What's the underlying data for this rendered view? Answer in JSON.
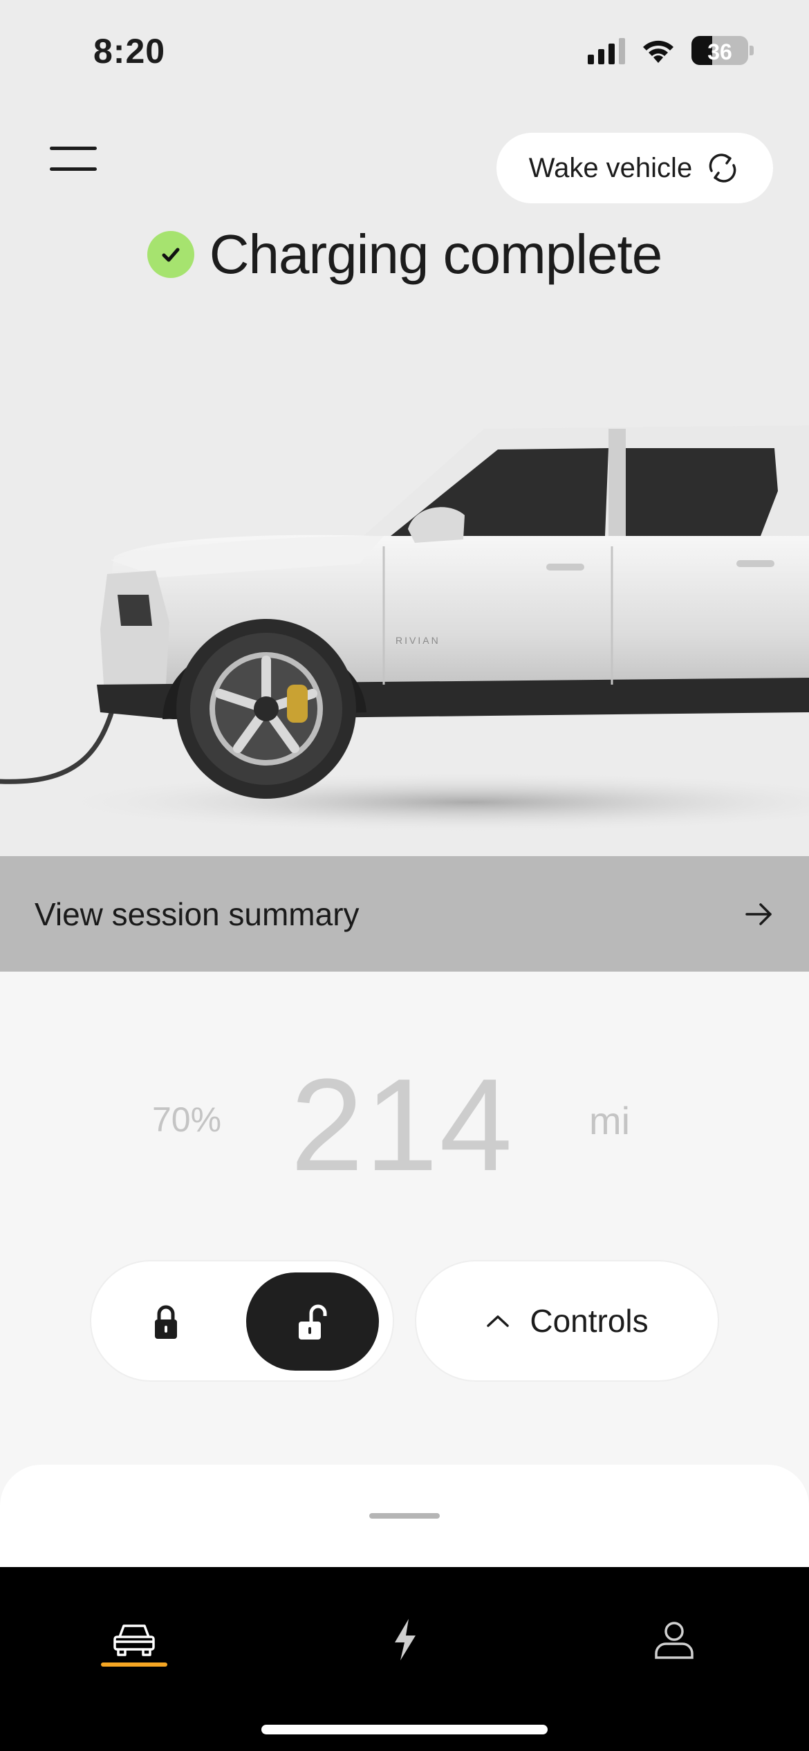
{
  "status_bar": {
    "time": "8:20",
    "battery_level": "36",
    "icons": [
      "cellular-signal-icon",
      "wifi-icon",
      "battery-icon"
    ]
  },
  "header": {
    "menu_icon": "hamburger-menu-icon",
    "wake_label": "Wake vehicle",
    "wake_icon": "refresh-icon"
  },
  "charge_status": {
    "text": "Charging complete",
    "icon": "check-circle-icon",
    "accent_color": "#a6e36f"
  },
  "vehicle": {
    "badge_text": "RIVIAN"
  },
  "session": {
    "label": "View session summary",
    "icon": "arrow-right-icon"
  },
  "range": {
    "percent": "70%",
    "value": "214",
    "unit": "mi"
  },
  "lock_controls": {
    "locked_icon": "lock-closed-icon",
    "unlocked_icon": "lock-open-icon",
    "selected": "unlocked"
  },
  "controls": {
    "label": "Controls",
    "icon": "chevron-up-icon"
  },
  "tab_bar": {
    "tabs": [
      {
        "icon": "vehicle-icon",
        "active": true
      },
      {
        "icon": "charging-bolt-icon",
        "active": false
      },
      {
        "icon": "profile-icon",
        "active": false
      }
    ],
    "active_color": "#f5a623"
  }
}
